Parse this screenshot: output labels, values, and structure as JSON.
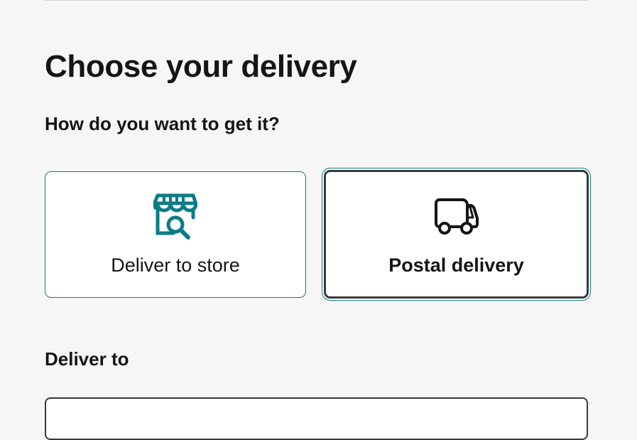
{
  "page": {
    "title": "Choose your delivery",
    "question": "How do you want to get it?",
    "deliver_to_heading": "Deliver to"
  },
  "options": [
    {
      "label": "Deliver to store",
      "icon": "store-search-icon",
      "selected": false
    },
    {
      "label": "Postal delivery",
      "icon": "truck-icon",
      "selected": true
    }
  ],
  "colors": {
    "background": "#f6f6f6",
    "accent": "#0b7c87",
    "selected_border": "#3a3a3a",
    "text": "#151515"
  }
}
